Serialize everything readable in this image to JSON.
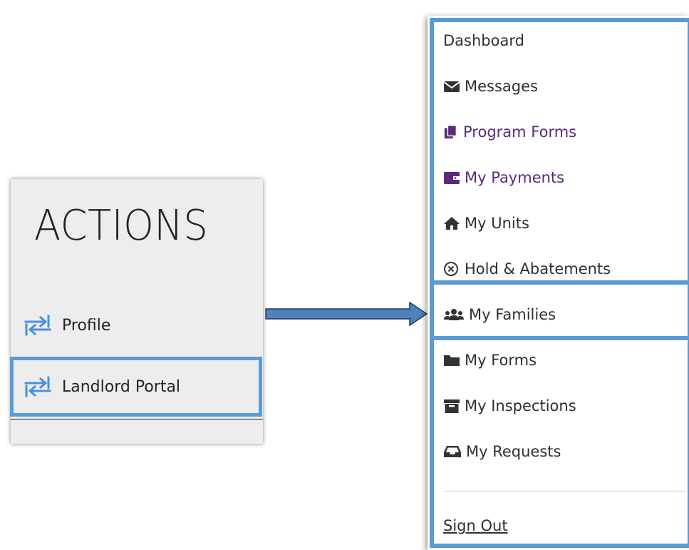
{
  "actions_panel": {
    "title": "ACTIONS",
    "items": [
      {
        "label": "Profile",
        "icon": "swap-arrows-icon"
      },
      {
        "label": "Landlord Portal",
        "icon": "swap-arrows-icon",
        "highlighted": true
      }
    ]
  },
  "nav_menu": {
    "items": [
      {
        "label": "Dashboard"
      },
      {
        "label": "Messages",
        "icon": "envelope-icon"
      },
      {
        "label": "Program Forms",
        "icon": "documents-icon"
      },
      {
        "label": "My Payments",
        "icon": "wallet-icon"
      },
      {
        "label": "My Units",
        "icon": "home-icon"
      },
      {
        "label": "Hold & Abatements",
        "icon": "circle-x-icon"
      },
      {
        "label": "My Families",
        "icon": "users-icon",
        "highlighted": true
      },
      {
        "label": "My Forms",
        "icon": "folder-icon"
      },
      {
        "label": "My Inspections",
        "icon": "archive-icon"
      },
      {
        "label": "My Requests",
        "icon": "inbox-icon"
      }
    ],
    "sign_out": "Sign Out"
  },
  "colors": {
    "highlight_border": "#5b9bd5",
    "arrow_fill": "#4f81bd",
    "accent_purple": "#5b2a7a",
    "icon_blue": "#4a8fe2"
  }
}
